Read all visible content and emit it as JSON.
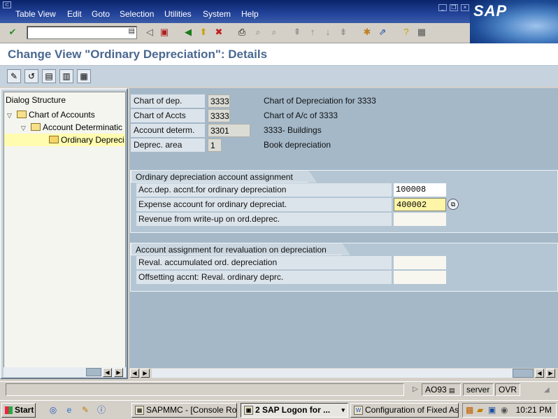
{
  "menubar": {
    "items": [
      {
        "label": "Table View",
        "u": "T"
      },
      {
        "label": "Edit",
        "u": "E"
      },
      {
        "label": "Goto",
        "u": "G"
      },
      {
        "label": "Selection",
        "u": "S"
      },
      {
        "label": "Utilities",
        "u": ""
      },
      {
        "label": "System",
        "u": "S"
      },
      {
        "label": "Help",
        "u": "H"
      }
    ],
    "logo": "SAP"
  },
  "toolbar": {
    "command_value": ""
  },
  "title": "Change View \"Ordinary Depreciation\": Details",
  "tree": {
    "header": "Dialog Structure",
    "nodes": [
      {
        "label": "Chart of Accounts"
      },
      {
        "label": "Account Determinatic"
      },
      {
        "label": "Ordinary Depreci"
      }
    ]
  },
  "header_fields": [
    {
      "label": "Chart of dep.",
      "value": "3333",
      "desc": "Chart of Depreciation for 3333"
    },
    {
      "label": "Chart of Accts",
      "value": "3333",
      "desc": "Chart of A/c of 3333"
    },
    {
      "label": "Account determ.",
      "value": "3301",
      "desc": "3333- Buildings"
    },
    {
      "label": "Deprec. area",
      "value": "1",
      "desc": "Book depreciation"
    }
  ],
  "group1": {
    "title": "Ordinary depreciation account assignment",
    "rows": [
      {
        "label": "Acc.dep. accnt.for ordinary depreciation",
        "value": "100008"
      },
      {
        "label": "Expense account for ordinary depreciat.",
        "value": "400002"
      },
      {
        "label": "Revenue from write-up on ord.deprec.",
        "value": ""
      }
    ]
  },
  "group2": {
    "title": "Account assignment for revaluation on depreciation",
    "rows": [
      {
        "label": "Reval. accumulated ord. depreciation",
        "value": ""
      },
      {
        "label": "Offsetting accnt: Reval. ordinary deprc.",
        "value": ""
      }
    ]
  },
  "status": {
    "transaction": "AO93",
    "server": "server",
    "mode": "OVR"
  },
  "taskbar": {
    "start": "Start",
    "tasks": [
      {
        "label": "SAPMMC - [Console Ro..."
      },
      {
        "label": "2 SAP Logon for ..."
      },
      {
        "label": "Configuration of Fixed As..."
      }
    ],
    "clock": "10:21 PM"
  },
  "colors": {
    "accent": "#0a246a",
    "title_text": "#4a6890",
    "main_bg": "#a4b8c8",
    "focus_field": "#fff5a8"
  }
}
